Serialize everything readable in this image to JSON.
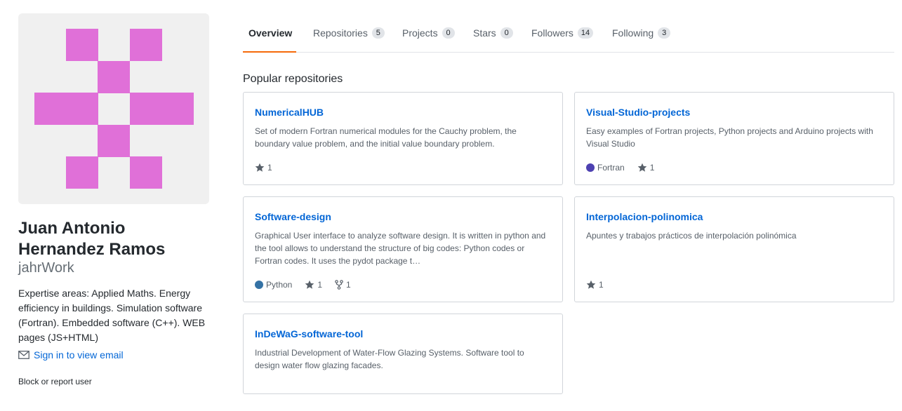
{
  "profile": {
    "full_name": "Juan Antonio Hernandez Ramos",
    "username": "jahrWork",
    "bio": "Expertise areas: Applied Maths. Energy efficiency in buildings. Simulation software (Fortran). Embedded software (C++). WEB pages (JS+HTML)",
    "email_link": "Sign in to view email",
    "block_report": "Block or report user",
    "avatar_color": "#e070d8"
  },
  "tabs": [
    {
      "label": "Overview",
      "count": null,
      "active": true
    },
    {
      "label": "Repositories",
      "count": "5"
    },
    {
      "label": "Projects",
      "count": "0"
    },
    {
      "label": "Stars",
      "count": "0"
    },
    {
      "label": "Followers",
      "count": "14"
    },
    {
      "label": "Following",
      "count": "3"
    }
  ],
  "popular": {
    "title": "Popular repositories",
    "repos": [
      {
        "name": "NumericalHUB",
        "description": "Set of modern Fortran numerical modules for the Cauchy problem, the boundary value problem, and the initial value boundary problem.",
        "language": "",
        "stars": "1",
        "forks": ""
      },
      {
        "name": "Visual-Studio-projects",
        "description": "Easy examples of Fortran projects, Python projects and Arduino projects with Visual Studio",
        "language": "Fortran",
        "language_color": "#4d41b1",
        "stars": "1",
        "forks": ""
      },
      {
        "name": "Software-design",
        "description": "Graphical User interface to analyze software design. It is written in python and the tool allows to understand the structure of big codes: Python codes or Fortran codes. It uses the pydot package t…",
        "language": "Python",
        "language_color": "#3572a5",
        "stars": "1",
        "forks": "1"
      },
      {
        "name": "Interpolacion-polinomica",
        "description": "Apuntes y trabajos prácticos de interpolación polinómica",
        "language": "",
        "stars": "1",
        "forks": ""
      },
      {
        "name": "InDeWaG-software-tool",
        "description": "Industrial Development of Water-Flow Glazing Systems. Software tool to design water flow glazing facades.",
        "language": "",
        "stars": "",
        "forks": ""
      }
    ]
  },
  "icons": {
    "email": "mail-icon",
    "star": "star-icon",
    "fork": "fork-icon"
  }
}
